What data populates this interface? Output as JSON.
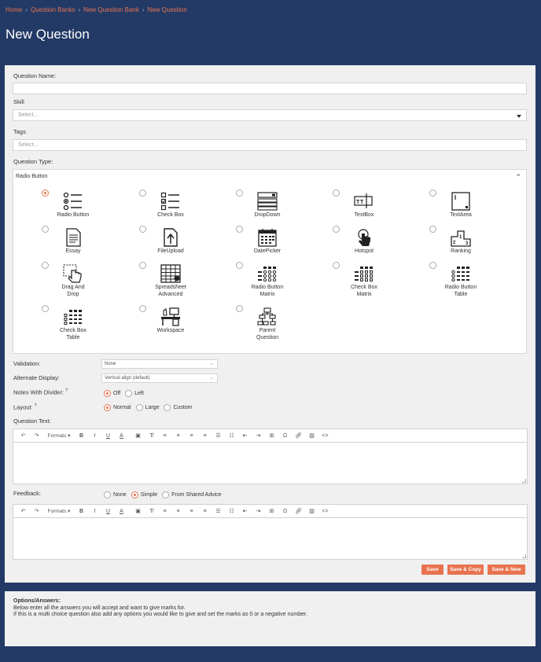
{
  "breadcrumb": [
    "Home",
    "Question Banks",
    "New Question Bank",
    "New Question"
  ],
  "page_title": "New Question",
  "form": {
    "question_name_label": "Question Name:",
    "skill_label": "Skill",
    "skill_placeholder": "Select...",
    "tags_label": "Tags",
    "tags_placeholder": "Select...",
    "question_type_label": "Question Type:",
    "question_type_selected": "Radio Button",
    "question_types": [
      {
        "label1": "Radio Button",
        "label2": "",
        "icon": "radio-list-icon",
        "selected": true
      },
      {
        "label1": "Check Box",
        "label2": "",
        "icon": "checkbox-list-icon",
        "selected": false
      },
      {
        "label1": "DropDown",
        "label2": "",
        "icon": "dropdown-icon",
        "selected": false
      },
      {
        "label1": "TextBox",
        "label2": "",
        "icon": "textbox-icon",
        "selected": false
      },
      {
        "label1": "TextArea",
        "label2": "",
        "icon": "textarea-icon",
        "selected": false
      },
      {
        "label1": "Essay",
        "label2": "",
        "icon": "document-icon",
        "selected": false
      },
      {
        "label1": "FileUpload",
        "label2": "",
        "icon": "file-upload-icon",
        "selected": false
      },
      {
        "label1": "DatePicker",
        "label2": "",
        "icon": "calendar-icon",
        "selected": false
      },
      {
        "label1": "Hotspot",
        "label2": "",
        "icon": "pointer-hand-icon",
        "selected": false
      },
      {
        "label1": "Ranking",
        "label2": "",
        "icon": "podium-icon",
        "selected": false
      },
      {
        "label1": "Drag And",
        "label2": "Drop",
        "icon": "drag-hand-icon",
        "selected": false
      },
      {
        "label1": "Spreadsheet",
        "label2": "Advanced",
        "icon": "spreadsheet-icon",
        "selected": false
      },
      {
        "label1": "Radio Button",
        "label2": "Matrix",
        "icon": "radio-matrix-icon",
        "selected": false
      },
      {
        "label1": "Check Box",
        "label2": "Matrix",
        "icon": "checkbox-matrix-icon",
        "selected": false
      },
      {
        "label1": "Radio Button",
        "label2": "Table",
        "icon": "radio-table-icon",
        "selected": false
      },
      {
        "label1": "Check Box",
        "label2": "Table",
        "icon": "checkbox-table-icon",
        "selected": false
      },
      {
        "label1": "Workspace",
        "label2": "",
        "icon": "workspace-icon",
        "selected": false
      },
      {
        "label1": "Parent",
        "label2": "Question",
        "icon": "hierarchy-icon",
        "selected": false
      }
    ],
    "validation_label": "Validation:",
    "validation_value": "None",
    "alt_display_label": "Alternate Display:",
    "alt_display_value": "Vertical align (default)",
    "notes_divider_label": "Notes With Divider:",
    "notes_divider_options": [
      "Off",
      "Left"
    ],
    "layout_label": "Layout:",
    "layout_options": [
      "Normal",
      "Large",
      "Custom"
    ],
    "question_text_label": "Question Text:",
    "feedback_label": "Feedback:",
    "feedback_options": [
      "None",
      "Simple",
      "From Shared Advice"
    ],
    "help_mark": "?"
  },
  "editor": {
    "formats_label": "Formats",
    "bold": "B",
    "italic": "I",
    "underline": "U",
    "font_color": "A",
    "omega": "Ω",
    "code": "<>"
  },
  "buttons": {
    "save": "Save",
    "save_copy": "Save & Copy",
    "save_new": "Save & New"
  },
  "options": {
    "title": "Options/Answers:",
    "line1": "Below enter all the answers you will accept and want to give marks for.",
    "line2": "If this is a multi choice question also add any options you would like to give and set the marks as 0 or a negative number."
  },
  "colors": {
    "background": "#233a66",
    "accent": "#e8734f",
    "panel": "#f0f0f0"
  }
}
